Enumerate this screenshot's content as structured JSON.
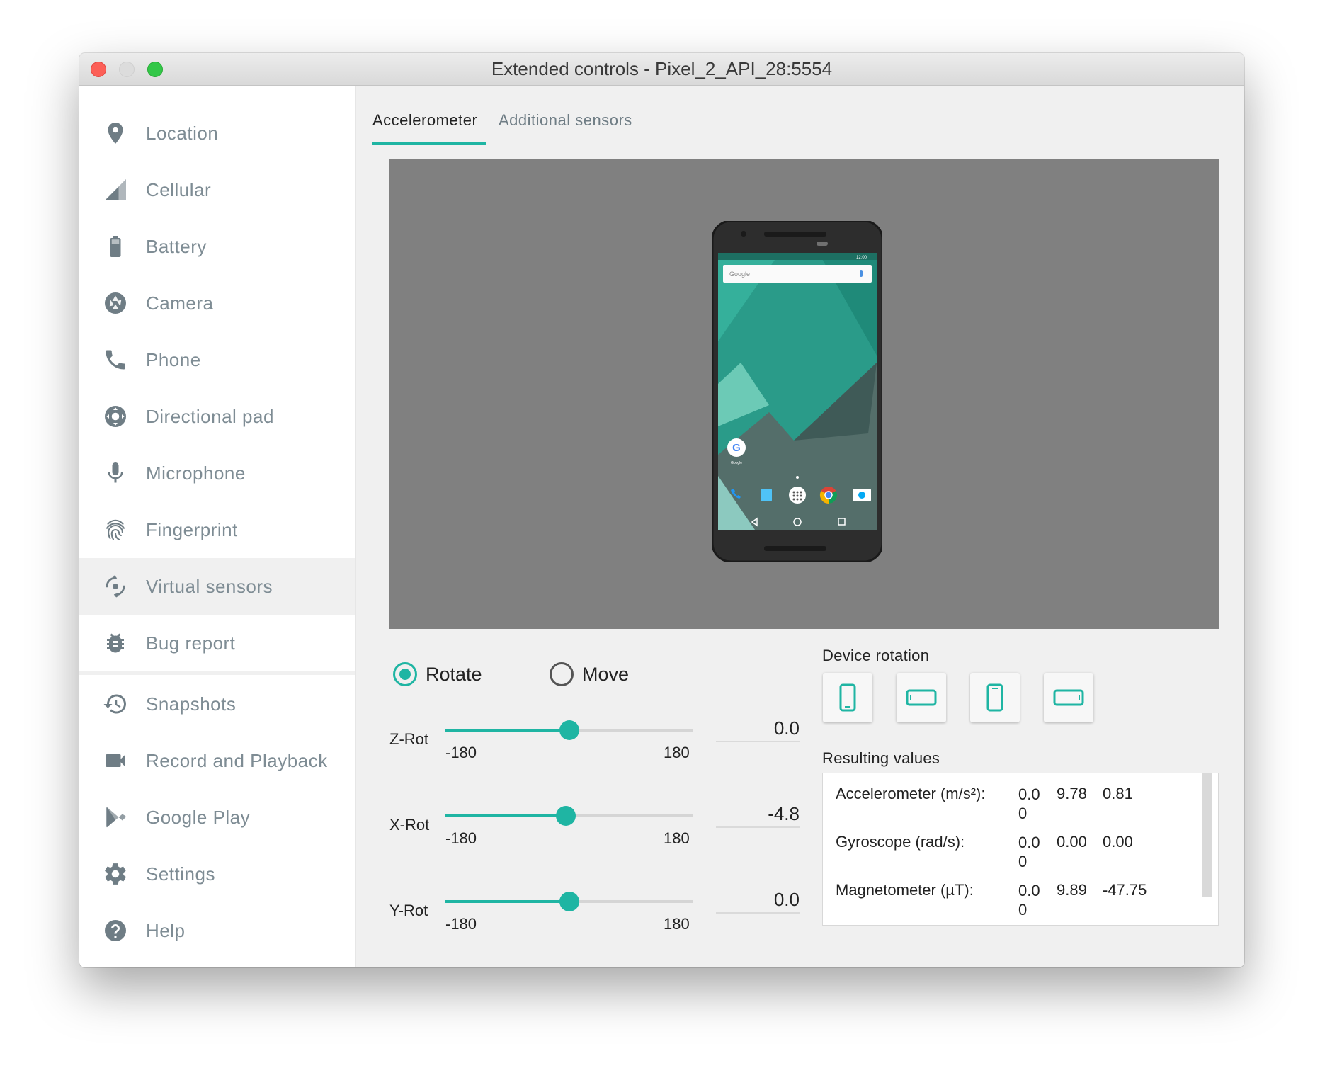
{
  "window": {
    "title": "Extended controls - Pixel_2_API_28:5554"
  },
  "sidebar": {
    "items": [
      {
        "label": "Location",
        "icon": "location-pin-icon"
      },
      {
        "label": "Cellular",
        "icon": "cellular-signal-icon"
      },
      {
        "label": "Battery",
        "icon": "battery-icon"
      },
      {
        "label": "Camera",
        "icon": "camera-aperture-icon"
      },
      {
        "label": "Phone",
        "icon": "phone-icon"
      },
      {
        "label": "Directional pad",
        "icon": "dpad-icon"
      },
      {
        "label": "Microphone",
        "icon": "microphone-icon"
      },
      {
        "label": "Fingerprint",
        "icon": "fingerprint-icon"
      },
      {
        "label": "Virtual sensors",
        "icon": "virtual-sensors-icon",
        "active": true
      },
      {
        "label": "Bug report",
        "icon": "bug-icon"
      },
      {
        "label": "Snapshots",
        "icon": "history-icon"
      },
      {
        "label": "Record and Playback",
        "icon": "video-camera-icon"
      },
      {
        "label": "Google Play",
        "icon": "google-play-icon"
      },
      {
        "label": "Settings",
        "icon": "gear-icon"
      },
      {
        "label": "Help",
        "icon": "help-icon"
      }
    ]
  },
  "tabs": {
    "accelerometer": "Accelerometer",
    "additional": "Additional sensors"
  },
  "phone_screen": {
    "search_text": "Google",
    "status_time": "12:00",
    "app_label": "Google"
  },
  "mode": {
    "rotate": "Rotate",
    "move": "Move",
    "selected": "Rotate"
  },
  "sliders": [
    {
      "label": "Z-Rot",
      "min": "-180",
      "max": "180",
      "value": "0.0",
      "numeric": 0.0
    },
    {
      "label": "X-Rot",
      "min": "-180",
      "max": "180",
      "value": "-4.8",
      "numeric": -4.8
    },
    {
      "label": "Y-Rot",
      "min": "-180",
      "max": "180",
      "value": "0.0",
      "numeric": 0.0
    }
  ],
  "device_rotation": {
    "label": "Device rotation",
    "buttons": [
      "portrait-icon",
      "landscape-icon",
      "reverse-portrait-icon",
      "reverse-landscape-icon"
    ]
  },
  "results": {
    "label": "Resulting values",
    "rows": [
      {
        "name": "Accelerometer (m/s²):",
        "v1": "0.00",
        "v2": "9.78",
        "v3": "0.81"
      },
      {
        "name": "Gyroscope (rad/s):",
        "v1": "0.00",
        "v2": "0.00",
        "v3": "0.00"
      },
      {
        "name": "Magnetometer (µT):",
        "v1": "0.00",
        "v2": "9.89",
        "v3": "-47.75"
      }
    ]
  },
  "colors": {
    "accent": "#1fb5a3",
    "sidebar_text": "#7e8c94",
    "viewport": "#808080"
  }
}
